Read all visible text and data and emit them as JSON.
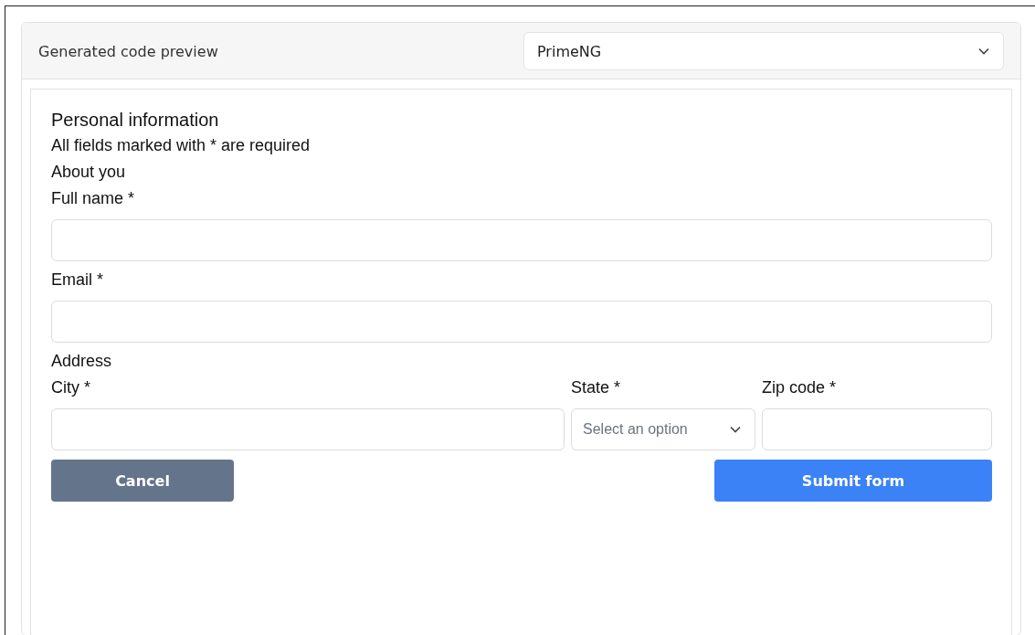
{
  "header": {
    "title": "Generated code preview",
    "framework_select": {
      "value": "PrimeNG"
    }
  },
  "form": {
    "title": "Personal information",
    "note": "All fields marked with * are required",
    "sections": [
      {
        "heading": "About you",
        "rows": [
          [
            {
              "label": "Full name *",
              "kind": "text"
            }
          ],
          [
            {
              "label": "Email *",
              "kind": "text"
            }
          ]
        ]
      },
      {
        "heading": "Address",
        "rows": [
          [
            {
              "label": "City *",
              "kind": "text"
            },
            {
              "label": "State *",
              "kind": "select",
              "placeholder": "Select an option"
            },
            {
              "label": "Zip code *",
              "kind": "text"
            }
          ]
        ]
      }
    ],
    "buttons": [
      {
        "label": "Cancel",
        "kind": "secondary"
      },
      {
        "label": "Submit form",
        "kind": "primary"
      }
    ]
  }
}
